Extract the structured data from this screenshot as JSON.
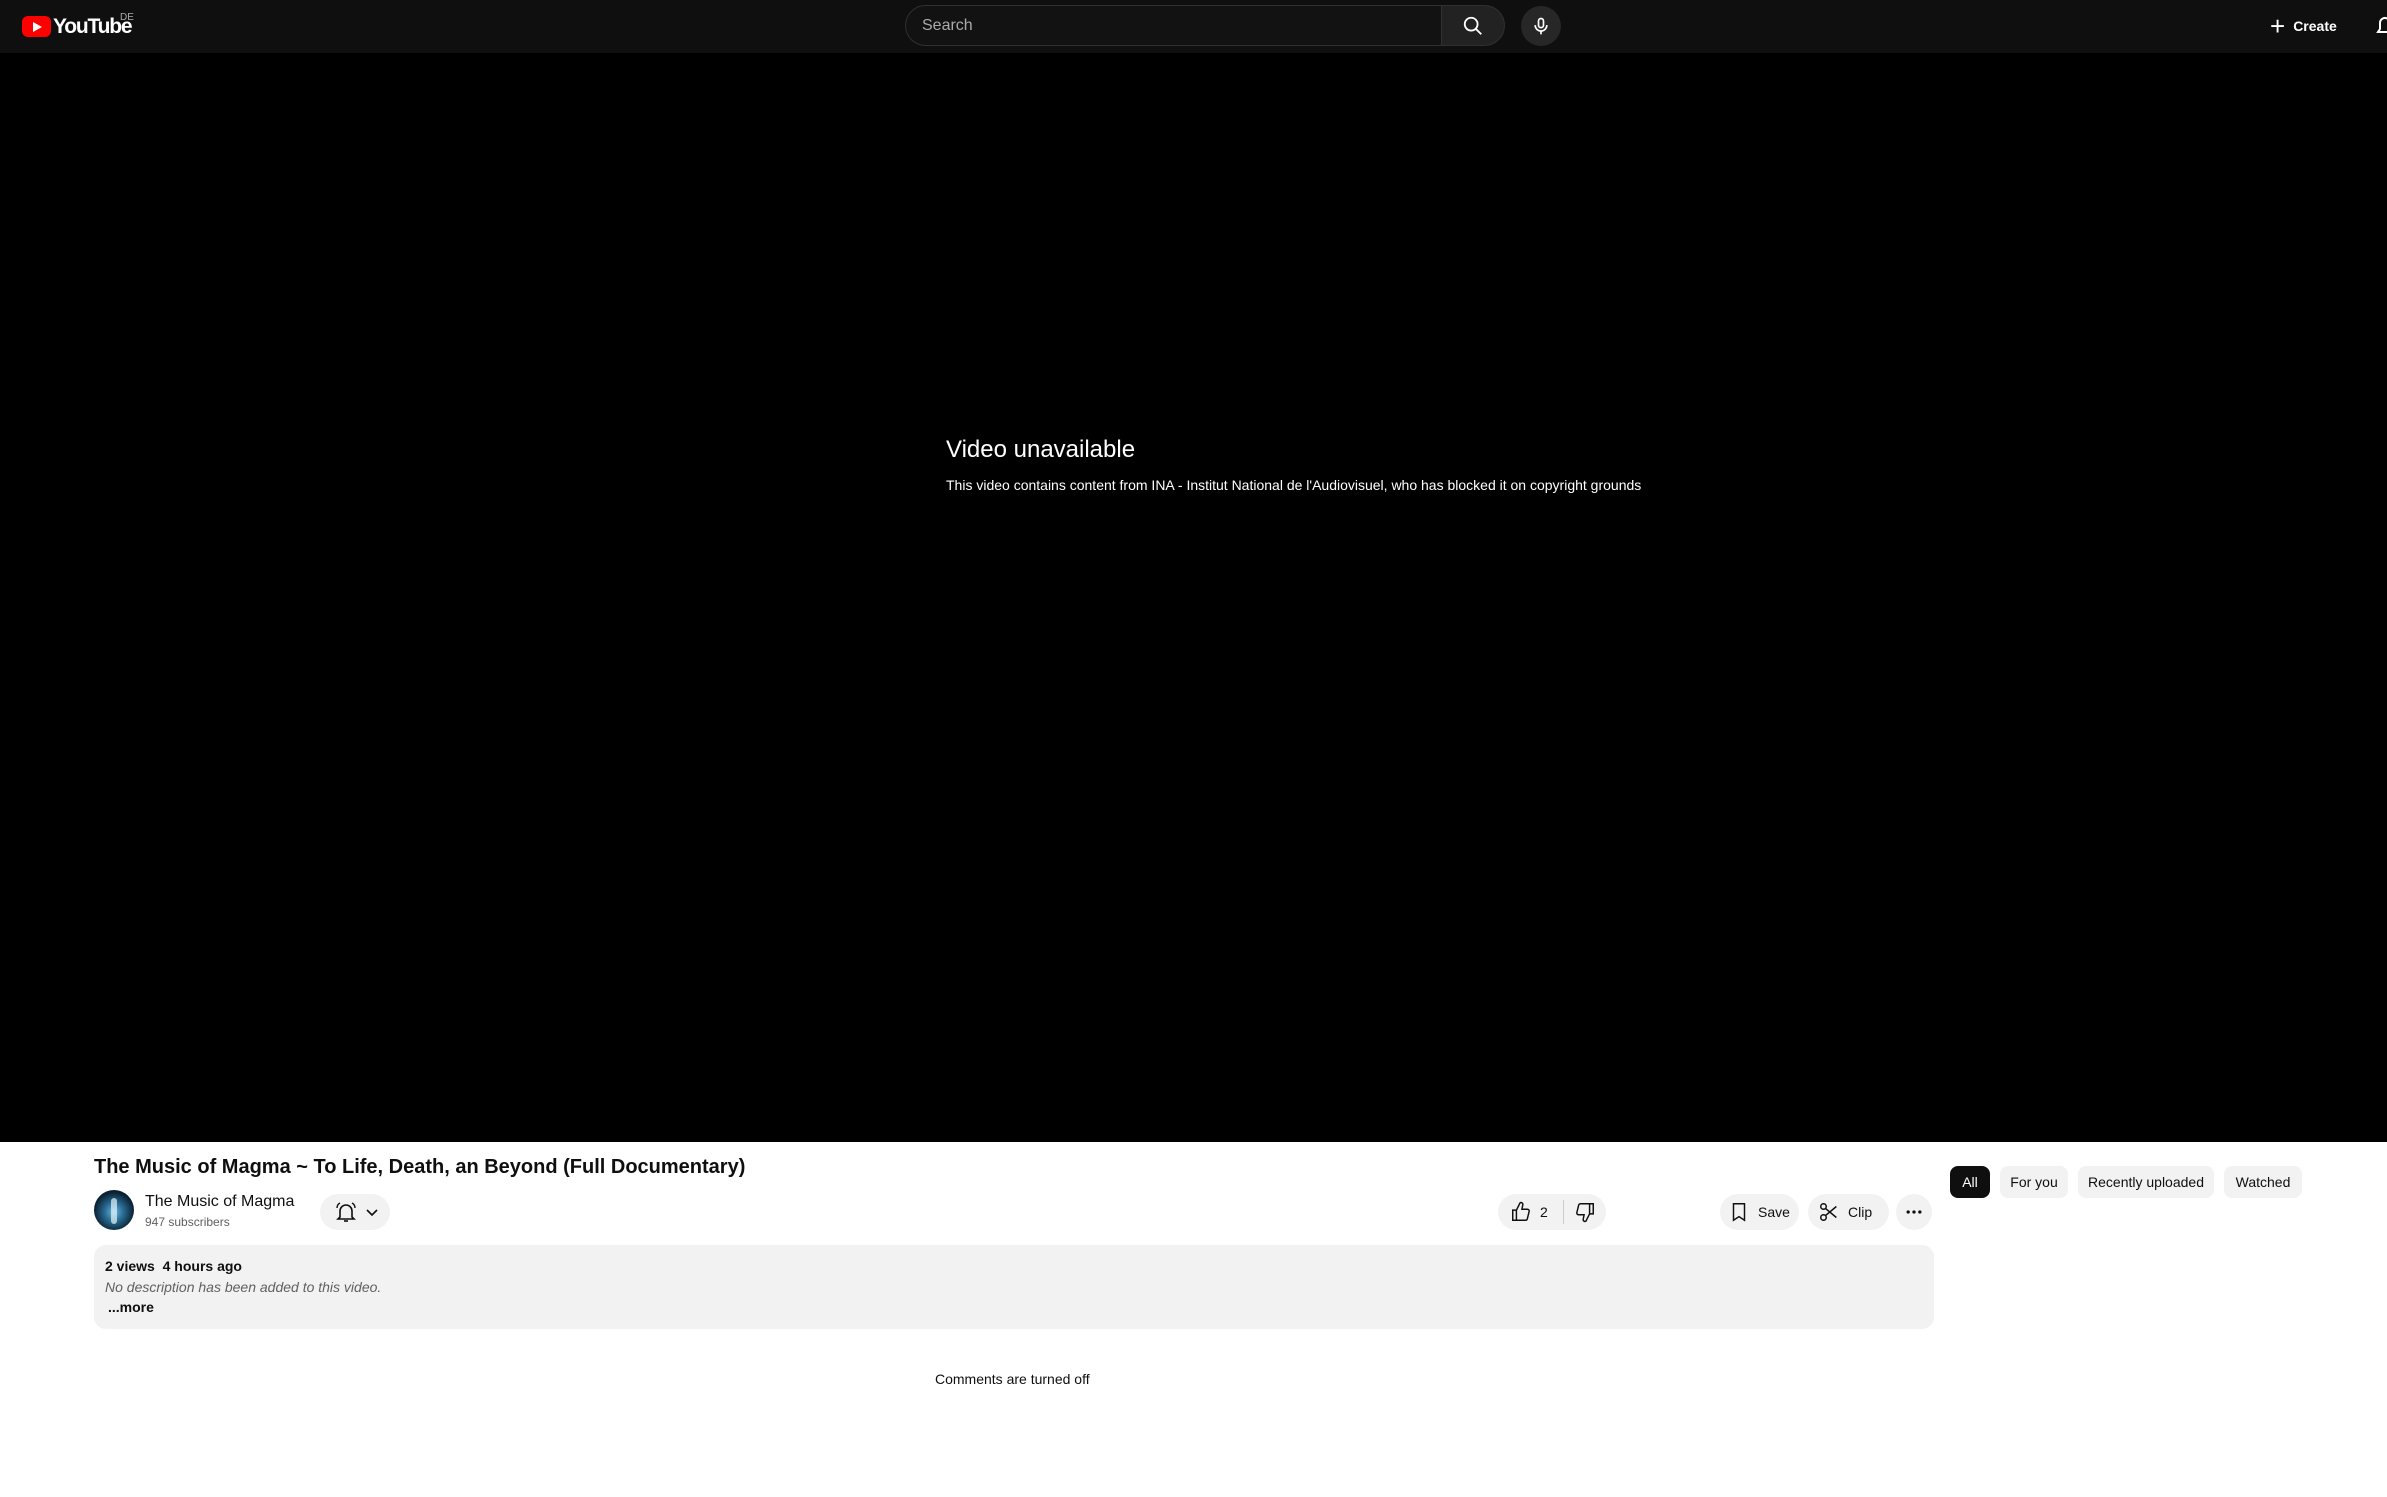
{
  "masthead": {
    "logo_text": "YouTube",
    "logo_region": "DE",
    "search_placeholder": "Search",
    "create_label": "Create"
  },
  "player": {
    "error_title": "Video unavailable",
    "error_message": "This video contains content from INA - Institut National de l'Audiovisuel, who has blocked it on copyright grounds"
  },
  "video": {
    "title": "The Music of Magma ~ To Life, Death, an Beyond (Full Documentary)",
    "channel_name": "The Music of Magma",
    "subscribers": "947 subscribers",
    "like_count": "2",
    "save_label": "Save",
    "clip_label": "Clip",
    "views": "2 views",
    "uploaded": "4 hours ago",
    "description": "No description has been added to this video.",
    "more_label": "...more",
    "comments_status": "Comments are turned off"
  },
  "chips": [
    {
      "label": "All",
      "active": true
    },
    {
      "label": "For you",
      "active": false
    },
    {
      "label": "Recently uploaded",
      "active": false
    },
    {
      "label": "Watched",
      "active": false
    }
  ],
  "colors": {
    "masthead_bg": "#0f0f0f",
    "logo_red": "#ff0000",
    "player_bg": "#000000",
    "pill_bg": "#f2f2f2"
  }
}
